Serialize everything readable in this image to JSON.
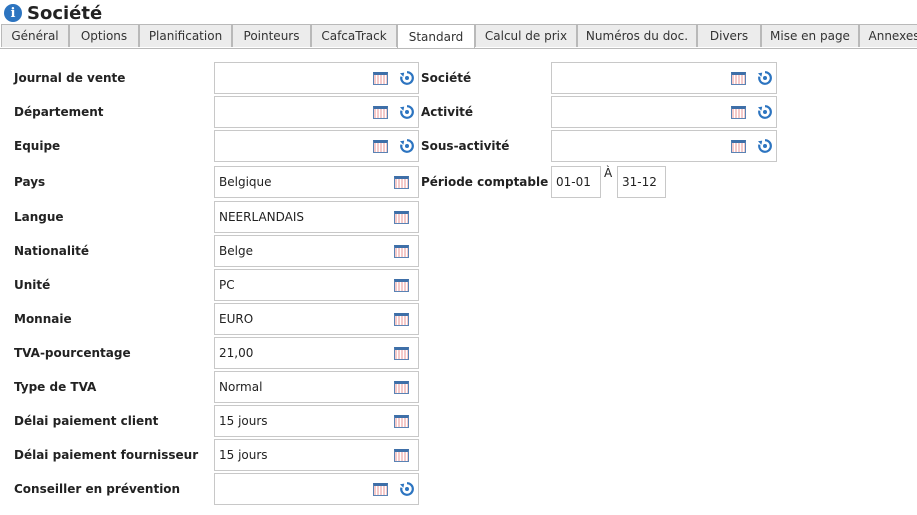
{
  "header": {
    "title": "Société",
    "info_icon": "info-icon"
  },
  "tabs": [
    {
      "label": "Général"
    },
    {
      "label": "Options"
    },
    {
      "label": "Planification"
    },
    {
      "label": "Pointeurs"
    },
    {
      "label": "CafcaTrack"
    },
    {
      "label": "Standard",
      "active": true
    },
    {
      "label": "Calcul de prix"
    },
    {
      "label": "Numéros du doc."
    },
    {
      "label": "Divers"
    },
    {
      "label": "Mise en page"
    },
    {
      "label": "Annexes"
    }
  ],
  "left_fields": [
    {
      "label": "Journal de vente",
      "value": "",
      "reset": true
    },
    {
      "label": "Département",
      "value": "",
      "reset": true
    },
    {
      "label": "Equipe",
      "value": "",
      "reset": true
    },
    {
      "label": "Pays",
      "value": "Belgique",
      "reset": false
    },
    {
      "label": "Langue",
      "value": "NEERLANDAIS",
      "reset": false
    },
    {
      "label": "Nationalité",
      "value": "Belge",
      "reset": false
    },
    {
      "label": "Unité",
      "value": "PC",
      "reset": false
    },
    {
      "label": "Monnaie",
      "value": "EURO",
      "reset": false
    },
    {
      "label": "TVA-pourcentage",
      "value": "21,00",
      "reset": false
    },
    {
      "label": "Type de TVA",
      "value": "Normal",
      "reset": false
    },
    {
      "label": "Délai paiement client",
      "value": "15 jours",
      "reset": false
    },
    {
      "label": "Délai paiement fournisseur",
      "value": "15 jours",
      "reset": false
    },
    {
      "label": "Conseiller en prévention",
      "value": "",
      "reset": true
    }
  ],
  "right_fields": [
    {
      "label": "Société",
      "value": ""
    },
    {
      "label": "Activité",
      "value": ""
    },
    {
      "label": "Sous-activité",
      "value": ""
    }
  ],
  "period": {
    "label": "Période comptable",
    "from": "01-01",
    "separator": "À",
    "to": "31-12"
  },
  "colors": {
    "accent": "#2c74c0",
    "border": "#c8c8c8",
    "tab_bg": "#ececec"
  }
}
